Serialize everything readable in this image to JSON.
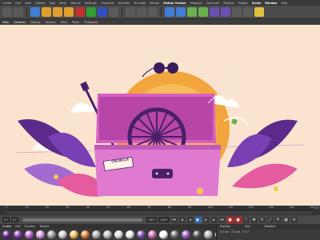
{
  "menubar": {
    "items": [
      "Create",
      "Edit",
      "View",
      "Objects",
      "Tags",
      "Mesh",
      "Volume",
      "MoGraph",
      "Character",
      "Animate",
      "Simulate",
      "Render",
      "Motion Tracker",
      "Mograph",
      "Character",
      "Pipeline",
      "Plugins",
      "Script",
      "Window",
      "Help"
    ]
  },
  "toolbar": {
    "icons": [
      {
        "name": "undo-icon",
        "color": "#5a5a5a"
      },
      {
        "name": "redo-icon",
        "color": "#5a5a5a"
      },
      {
        "name": "live-selection-icon",
        "color": "#3f7fd6"
      },
      {
        "name": "move-icon",
        "color": "#e0a030"
      },
      {
        "name": "scale-icon",
        "color": "#e0a030"
      },
      {
        "name": "rotate-icon",
        "color": "#e0a030"
      },
      {
        "name": "x-axis-icon",
        "color": "#c03030"
      },
      {
        "name": "y-axis-icon",
        "color": "#30a030"
      },
      {
        "name": "z-axis-icon",
        "color": "#3050c0"
      },
      {
        "name": "coordinate-system-icon",
        "color": "#5a5a5a"
      },
      {
        "name": "render-view-icon",
        "color": "#5a5a5a"
      },
      {
        "name": "render-to-picture-viewer-icon",
        "color": "#5a5a5a"
      },
      {
        "name": "render-settings-icon",
        "color": "#5a5a5a"
      },
      {
        "name": "cube-icon",
        "color": "#3f7fd6"
      },
      {
        "name": "pen-icon",
        "color": "#3f7fd6"
      },
      {
        "name": "subdivision-icon",
        "color": "#6ab04c"
      },
      {
        "name": "array-icon",
        "color": "#6ab04c"
      },
      {
        "name": "cloner-icon",
        "color": "#6a50b0"
      },
      {
        "name": "deformer-icon",
        "color": "#6a50b0"
      },
      {
        "name": "floor-icon",
        "color": "#5a5a5a"
      },
      {
        "name": "camera-icon",
        "color": "#5a5a5a"
      },
      {
        "name": "light-icon",
        "color": "#e0c040"
      }
    ]
  },
  "viewmenu": {
    "items": [
      "View",
      "Cameras",
      "Display",
      "Options",
      "Filter",
      "Panel",
      "ProRender"
    ]
  },
  "viewport": {
    "poster_text": "COACHELLA",
    "colors": {
      "bg": "#fbe4cf",
      "sun": "#f2a53c",
      "trunk": "#d65fc0",
      "leaf": "#5b2a8a",
      "wheel": "#4a1f6a"
    }
  },
  "timeline": {
    "ticks": [
      "0",
      "10",
      "20",
      "30",
      "40",
      "50",
      "60",
      "70",
      "80",
      "90",
      "100",
      "110",
      "120",
      "130",
      "140",
      "150"
    ],
    "frame": "0 F"
  },
  "transport": {
    "start": "0 F",
    "current": "0 F",
    "end": "150 F",
    "end2": "150 F"
  },
  "materials": {
    "tabs": [
      "Create",
      "Edit",
      "Function",
      "Texture"
    ],
    "swatches": [
      "#6b2a8f",
      "#8a3fb0",
      "#c06ad8",
      "#d9a0e8",
      "#a0a0a0",
      "#d0d0d0",
      "#f0c060",
      "#e08040",
      "#b0b0b0",
      "#c0c0c0",
      "#e0e0e0",
      "#f0f0f0",
      "#8050b0",
      "#d070b0",
      "#ffffff",
      "#707070",
      "#a060c0",
      "#5a5a5a",
      "#b8b8b8",
      "#e0e0e0"
    ]
  },
  "coords": {
    "headers": [
      "Position",
      "Size",
      "Rotation"
    ],
    "row": [
      "X 0 cm",
      "X 0 cm",
      "H 0 °"
    ]
  }
}
